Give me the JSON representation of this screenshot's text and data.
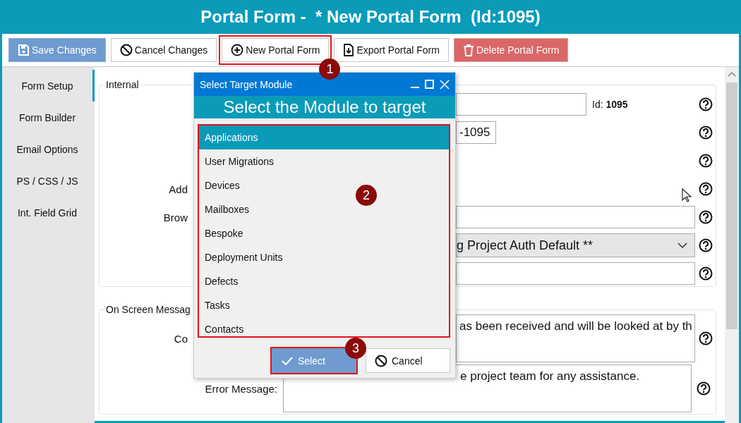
{
  "window": {
    "title": "Portal Form -  * New Portal Form  (Id:1095)"
  },
  "toolbar": [
    {
      "label": "Save Changes",
      "kind": "save"
    },
    {
      "label": "Cancel Changes",
      "kind": "cancel"
    },
    {
      "label": "New Portal Form",
      "kind": "new",
      "callout": "1"
    },
    {
      "label": "Export Portal Form",
      "kind": "export"
    },
    {
      "label": "Delete Portal Form",
      "kind": "delete"
    }
  ],
  "sidebar": {
    "items": [
      {
        "label": "Form Setup",
        "selected": true
      },
      {
        "label": "Form Builder",
        "selected": false
      },
      {
        "label": "Email Options",
        "selected": false
      },
      {
        "label": "PS / CSS / JS",
        "selected": false
      },
      {
        "label": "Int. Field Grid",
        "selected": false
      }
    ]
  },
  "internal": {
    "legend": "Internal",
    "rows": [
      {
        "kind": "text",
        "label": "",
        "value": "",
        "note": "Id: **1095**"
      },
      {
        "kind": "text",
        "label": "",
        "value": "-1095"
      },
      {
        "kind": "none",
        "label": ""
      },
      {
        "kind": "none",
        "label": "Add"
      },
      {
        "kind": "text",
        "label": "Brow",
        "value": ""
      },
      {
        "kind": "select",
        "label": "",
        "value": "g Project Auth Default **"
      },
      {
        "kind": "text",
        "label": "",
        "value": ""
      }
    ]
  },
  "messages": {
    "legend": "On Screen Messag",
    "rows": [
      {
        "label": "Co",
        "value": "as been received and will be looked at by th"
      },
      {
        "label": "Error Message:",
        "value": "e project team for any assistance."
      }
    ]
  },
  "dialog": {
    "title": "Select Target Module",
    "heading": "Select the Module to target",
    "callout": "2",
    "items": [
      {
        "label": "Applications",
        "selected": true
      },
      {
        "label": "User Migrations",
        "selected": false
      },
      {
        "label": "Devices",
        "selected": false
      },
      {
        "label": "Mailboxes",
        "selected": false
      },
      {
        "label": "Bespoke",
        "selected": false
      },
      {
        "label": "Deployment Units",
        "selected": false
      },
      {
        "label": "Defects",
        "selected": false
      },
      {
        "label": "Tasks",
        "selected": false
      },
      {
        "label": "Contacts",
        "selected": false
      }
    ],
    "buttons": [
      {
        "label": "Select",
        "kind": "primary",
        "callout": "3"
      },
      {
        "label": "Cancel",
        "kind": "cancel"
      }
    ]
  }
}
